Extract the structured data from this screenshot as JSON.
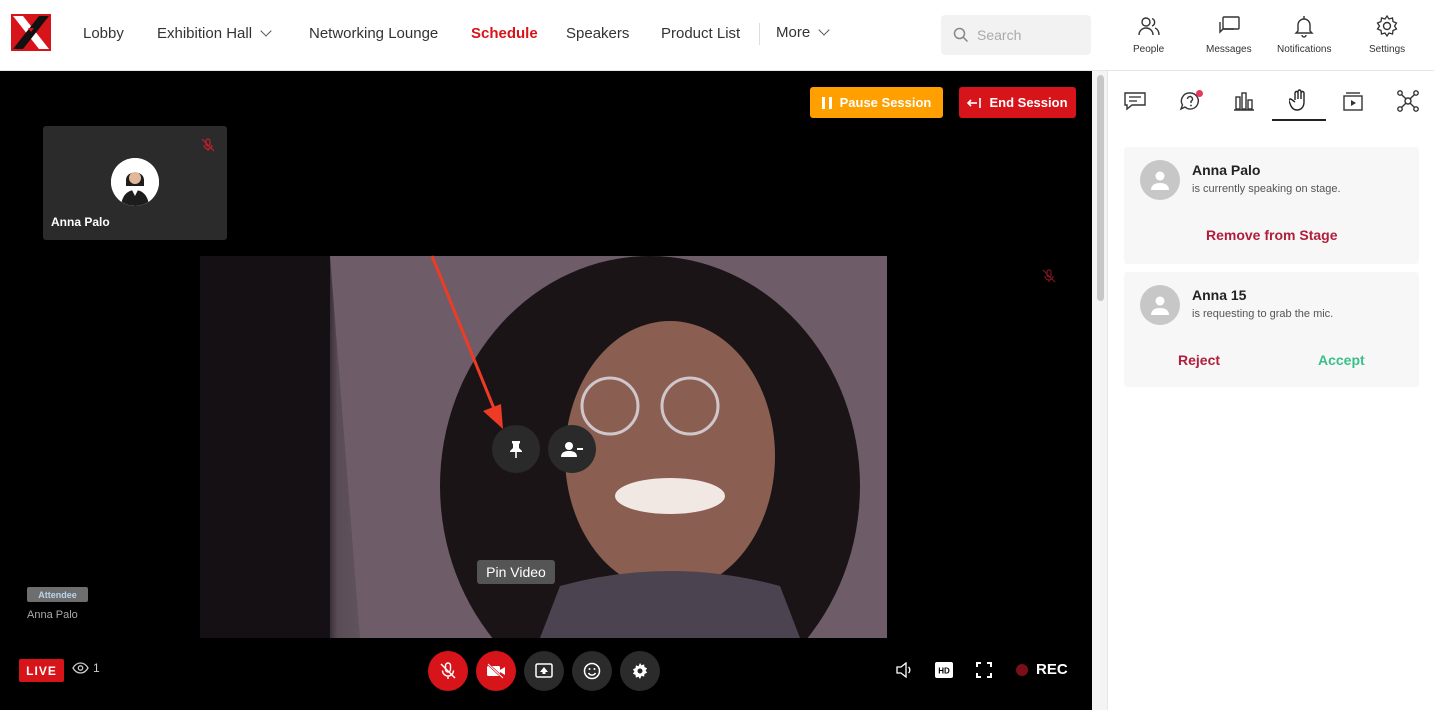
{
  "nav": {
    "items": [
      {
        "label": "Lobby"
      },
      {
        "label": "Exhibition Hall"
      },
      {
        "label": "Networking Lounge"
      },
      {
        "label": "Schedule"
      },
      {
        "label": "Speakers"
      },
      {
        "label": "Product List"
      },
      {
        "label": "More"
      }
    ],
    "active": "Schedule",
    "search_placeholder": "Search",
    "actions": [
      {
        "label": "People",
        "icon": "people-icon"
      },
      {
        "label": "Messages",
        "icon": "messages-icon"
      },
      {
        "label": "Notifications",
        "icon": "bell-icon"
      },
      {
        "label": "Settings",
        "icon": "gear-icon"
      }
    ]
  },
  "stage": {
    "pause_label": "Pause Session",
    "end_label": "End Session",
    "tile_name": "Anna Palo",
    "tooltip": "Pin Video",
    "role_badge": "Attendee",
    "role_name": "Anna Palo",
    "live_label": "LIVE",
    "viewer_count": "1",
    "rec_label": "REC"
  },
  "panel": {
    "tabs": [
      "chat-icon",
      "qna-icon",
      "poll-icon",
      "raise-hand-icon",
      "media-icon",
      "network-icon"
    ],
    "active_tab": "raise-hand-icon",
    "cards": [
      {
        "name": "Anna Palo",
        "desc": "is currently speaking on stage.",
        "action": "Remove from Stage"
      },
      {
        "name": "Anna 15",
        "desc": "is requesting to grab the mic.",
        "reject": "Reject",
        "accept": "Accept"
      }
    ]
  },
  "colors": {
    "brand": "#d7141a",
    "pause": "#ff9f00",
    "accept": "#3ac08a",
    "reject": "#b01e3c"
  }
}
